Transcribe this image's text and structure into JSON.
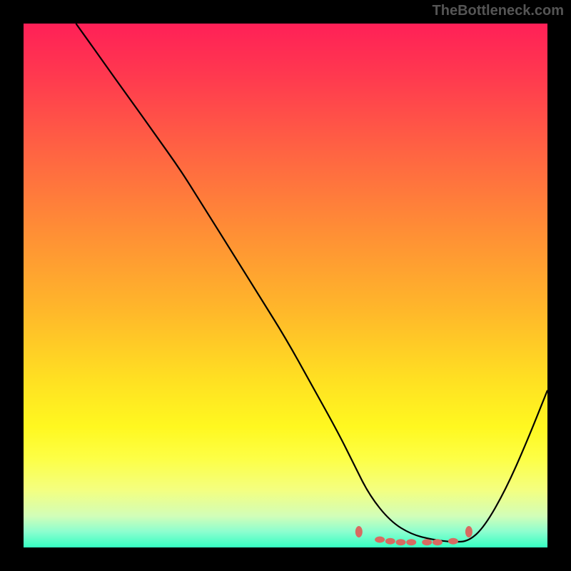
{
  "watermark": "TheBottleneck.com",
  "chart_data": {
    "type": "line",
    "title": "",
    "xlabel": "",
    "ylabel": "",
    "xlim": [
      0,
      100
    ],
    "ylim": [
      0,
      100
    ],
    "grid": false,
    "legend": false,
    "background_gradient": {
      "top_color": "#ff2057",
      "bottom_color": "#35ffc2",
      "description": "vertical gradient red→orange→yellow→green"
    },
    "series": [
      {
        "name": "bottleneck-curve",
        "description": "steep descent from top-left to a flat minimum near the lower-right then rises",
        "x": [
          10,
          15,
          20,
          25,
          30,
          35,
          40,
          45,
          50,
          55,
          60,
          63,
          66,
          70,
          74,
          78,
          82,
          85,
          88,
          92,
          96,
          100
        ],
        "y": [
          100,
          93,
          86,
          79,
          72,
          64,
          56,
          48,
          40,
          31,
          22,
          16,
          10,
          5,
          2.5,
          1.5,
          1,
          1.2,
          4,
          11,
          20,
          30
        ]
      },
      {
        "name": "bottleneck-region-markers",
        "description": "cluster of pale-red dots marking the flat minimum region",
        "type": "scatter",
        "x": [
          64,
          68,
          70,
          72,
          74,
          77,
          79,
          82,
          85
        ],
        "y": [
          3,
          1.5,
          1.2,
          1.0,
          1.0,
          1.0,
          1.0,
          1.2,
          3
        ]
      }
    ]
  }
}
